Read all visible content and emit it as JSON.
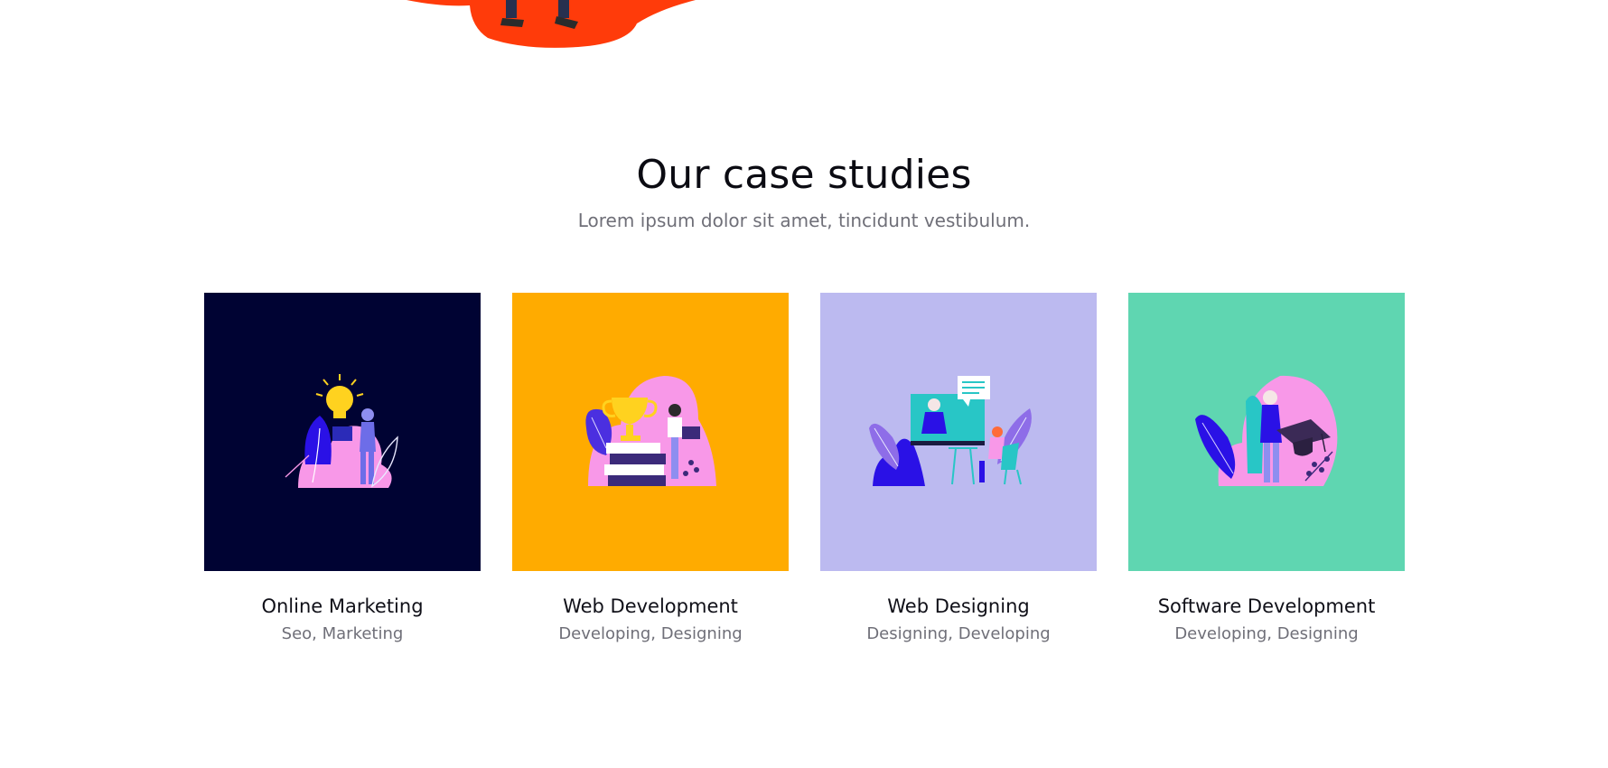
{
  "section": {
    "title": "Our case studies",
    "subtitle": "Lorem ipsum dolor sit amet, tincidunt vestibulum."
  },
  "colors": {
    "hero_accent": "#ff3b0a",
    "card_bgs": [
      "#000333",
      "#ffab00",
      "#bcbaf0",
      "#5fd6b1"
    ]
  },
  "cases": [
    {
      "title": "Online Marketing",
      "tags": "Seo, Marketing",
      "icon": "lightbulb-idea-illustration"
    },
    {
      "title": "Web Development",
      "tags": "Developing, Designing",
      "icon": "trophy-books-illustration"
    },
    {
      "title": "Web Designing",
      "tags": "Designing, Developing",
      "icon": "video-meeting-illustration"
    },
    {
      "title": "Software Development",
      "tags": "Developing, Designing",
      "icon": "graduation-cap-illustration"
    }
  ]
}
